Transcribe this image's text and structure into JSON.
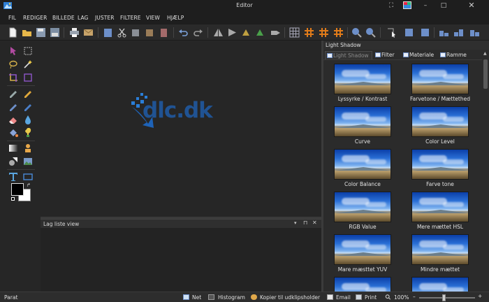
{
  "window": {
    "title": "Editor"
  },
  "menu": [
    "FIL",
    "REDIGER",
    "BILLEDE",
    "LAG",
    "JUSTER",
    "FILTERE",
    "VIEW",
    "HJÆLP"
  ],
  "toolbar": {
    "icons": [
      "new-file-icon",
      "open-folder-icon",
      "save-icon",
      "save-as-icon",
      "print-icon",
      "email-icon",
      "paste-icon",
      "cut-icon",
      "copy-icon",
      "paste-special-icon",
      "clipboard-icon",
      "undo-icon",
      "redo-icon",
      "flip-horizontal-icon",
      "flip-vertical-icon",
      "rotate-left-icon",
      "rotate-right-icon",
      "transform-icon",
      "grid-icon",
      "grid-snap-icon",
      "grid-guides-icon",
      "zoom-in-icon",
      "zoom-out-icon",
      "pointer-icon",
      "crop-icon",
      "resize-icon",
      "align-left-icon",
      "align-center-icon",
      "align-right-icon"
    ]
  },
  "canvas": {
    "watermark": "dlc.dk"
  },
  "layer_panel": {
    "title": "Lag liste view"
  },
  "effects_panel": {
    "title": "Light Shadow",
    "tabs": [
      "Light Shadow",
      "Filter",
      "Materiale",
      "Ramme"
    ],
    "active_tab": "Light Shadow",
    "presets": [
      "Lyssyrke / Kontrast",
      "Farvetone / Mættethed",
      "Curve",
      "Color Level",
      "Color Balance",
      "Farve tone",
      "RGB Value",
      "Mere mættet HSL",
      "Mare mæsttet YUV",
      "Mindre mættet",
      "",
      ""
    ]
  },
  "status": {
    "text": "Parat",
    "net": "Net",
    "histogram": "Histogram",
    "copy_clipboard": "Kopier til udklipsholder",
    "email": "Email",
    "print": "Print",
    "zoom": "100%"
  },
  "colors": {
    "accent": "#1e63b8",
    "foreground_color": "#000000",
    "background_color": "#ffffff",
    "grid_icon": "#e07b1a"
  }
}
